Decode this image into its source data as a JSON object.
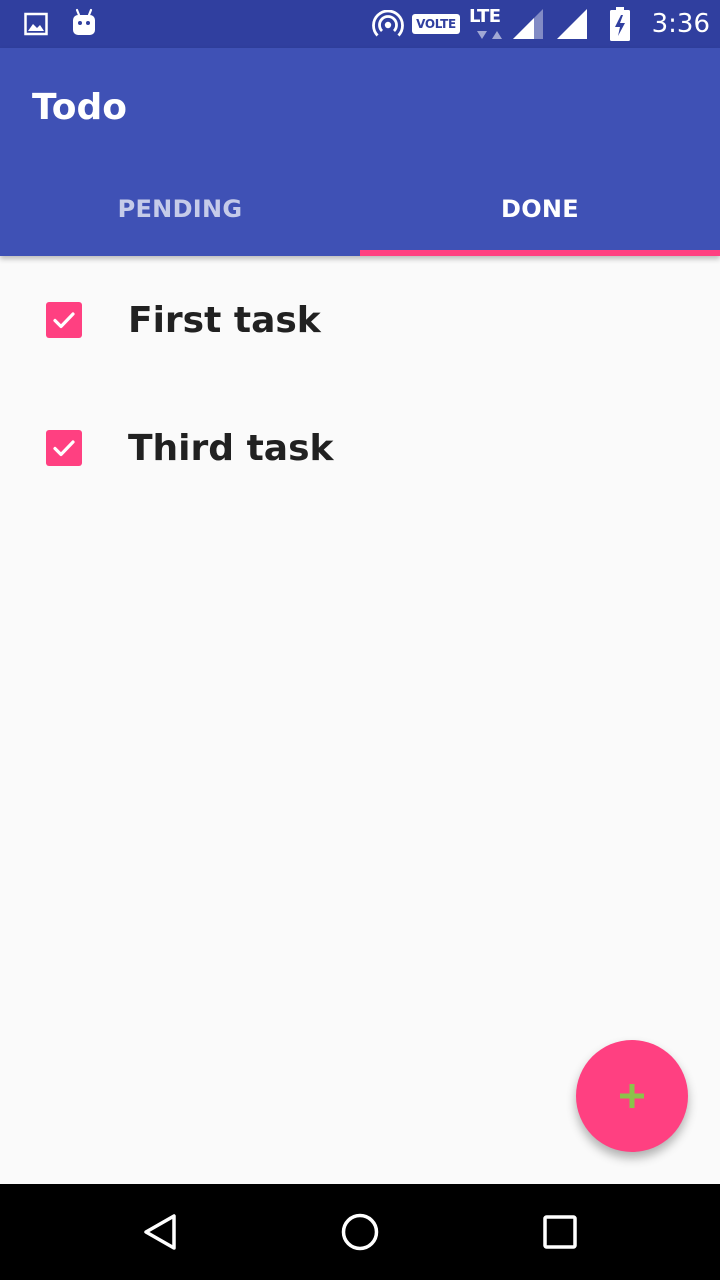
{
  "status_bar": {
    "volte_label": "VOLTE",
    "network_label": "LTE",
    "time": "3:36",
    "icons": [
      "gallery-icon",
      "android-icon",
      "hotspot-icon",
      "signal-icon",
      "battery-icon"
    ]
  },
  "app_bar": {
    "title": "Todo"
  },
  "tabs": [
    {
      "label": "PENDING",
      "selected": false
    },
    {
      "label": "DONE",
      "selected": true
    }
  ],
  "tasks": [
    {
      "label": "First task",
      "checked": true
    },
    {
      "label": "Third task",
      "checked": true
    }
  ],
  "fab": {
    "icon": "plus-icon"
  },
  "navigation": {
    "icons": [
      "back-icon",
      "home-icon",
      "recents-icon"
    ]
  },
  "colors": {
    "status_bar": "#303f9f",
    "primary": "#3f51b5",
    "accent": "#ff4081",
    "fab_icon": "#8bc34a",
    "background": "#fafafa",
    "text_primary": "#212121"
  }
}
